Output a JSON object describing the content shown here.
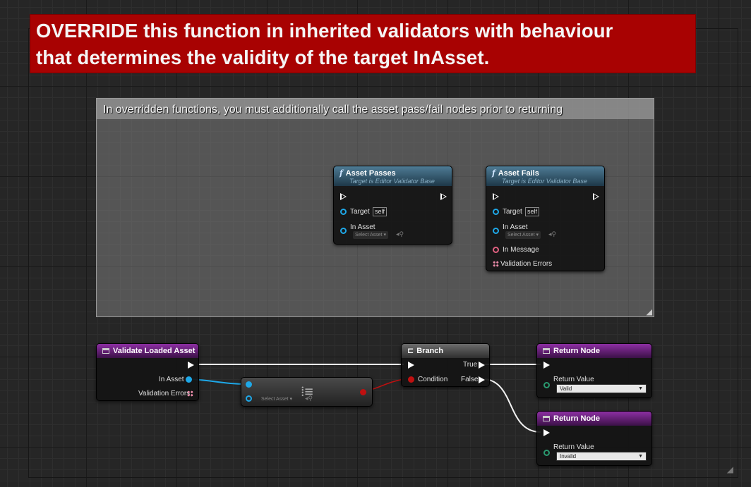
{
  "banner": {
    "line1": "OVERRIDE this function in inherited validators with behaviour",
    "line2": "that determines the validity of the target InAsset."
  },
  "comment": {
    "text": "In overridden functions, you must additionally call the asset pass/fail nodes prior to returning"
  },
  "asset_passes": {
    "title": "Asset Passes",
    "subtitle": "Target is Editor Validator Base",
    "target_label": "Target",
    "target_value": "self",
    "inasset_label": "In Asset",
    "select_label": "Select Asset"
  },
  "asset_fails": {
    "title": "Asset Fails",
    "subtitle": "Target is Editor Validator Base",
    "target_label": "Target",
    "target_value": "self",
    "inasset_label": "In Asset",
    "select_label": "Select Asset",
    "message_label": "In Message",
    "errors_label": "Validation Errors"
  },
  "validate_node": {
    "title": "Validate Loaded Asset",
    "inasset_label": "In Asset",
    "errors_label": "Validation Errors"
  },
  "isvalid_node": {
    "select_label": "Select Asset"
  },
  "branch": {
    "title": "Branch",
    "condition_label": "Condition",
    "true_label": "True",
    "false_label": "False"
  },
  "return_valid": {
    "title": "Return Node",
    "value_label": "Return Value",
    "value": "Valid"
  },
  "return_invalid": {
    "title": "Return Node",
    "value_label": "Return Value",
    "value": "Invalid"
  },
  "icons": {
    "function": "function-icon",
    "event": "event-icon",
    "branch": "branch-icon",
    "pure_node": "is-valid-icon"
  },
  "colors": {
    "banner": "#a80202",
    "object_pin": "#1ea8e8",
    "bool_pin": "#c01010",
    "string_pin": "#e06080",
    "enum_pin": "#2a9a70",
    "event_header": "#8d2fa3",
    "function_header": "#4e7b95"
  }
}
